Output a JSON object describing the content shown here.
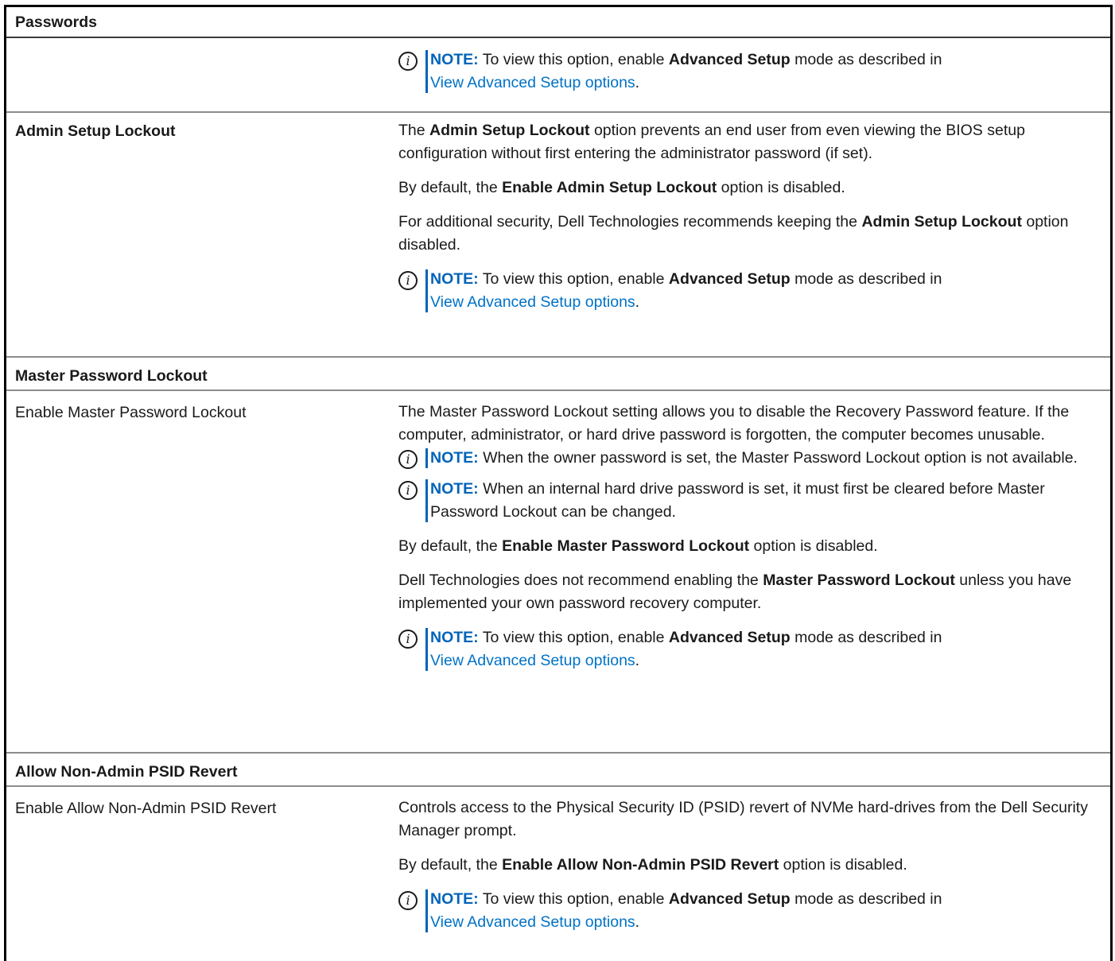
{
  "sections": {
    "passwords": {
      "title": "Passwords",
      "note": {
        "label": "NOTE:",
        "text_a": "To view this option, enable",
        "bold": "Advanced Setup",
        "text_b": "mode as described in",
        "link": "View Advanced Setup options",
        "end": "."
      }
    },
    "admin_lockout": {
      "label": "Admin Setup Lockout",
      "p1_a": "The",
      "p1_bold": "Admin Setup Lockout",
      "p1_b": "option prevents an end user from even viewing the BIOS setup configuration without first entering the administrator password (if set).",
      "p2_a": "By default, the",
      "p2_bold": "Enable Admin Setup Lockout",
      "p2_b": "option is disabled.",
      "p3_a": "For additional security, Dell Technologies recommends keeping the",
      "p3_bold": "Admin Setup Lockout",
      "p3_b": "option disabled.",
      "note": {
        "label": "NOTE:",
        "text_a": "To view this option, enable",
        "bold": "Advanced Setup",
        "text_b": "mode as described in",
        "link": "View Advanced Setup options",
        "end": "."
      }
    },
    "master_lockout": {
      "title": "Master Password Lockout",
      "label": "Enable Master Password Lockout",
      "p1": "The Master Password Lockout setting allows you to disable the Recovery Password feature. If the computer, administrator, or hard drive password is forgotten, the computer becomes unusable.",
      "note1_label": "NOTE:",
      "note1_text": "When the owner password is set, the Master Password Lockout option is not available.",
      "note2_label": "NOTE:",
      "note2_text": "When an internal hard drive password is set, it must first be cleared before Master Password Lockout can be changed.",
      "p2_a": "By default, the",
      "p2_bold": "Enable Master Password Lockout",
      "p2_b": "option is disabled.",
      "p3_a": "Dell Technologies does not recommend enabling the",
      "p3_bold": "Master Password Lockout",
      "p3_b": "unless you have implemented your own password recovery computer.",
      "note3": {
        "label": "NOTE:",
        "text_a": "To view this option, enable",
        "bold": "Advanced Setup",
        "text_b": "mode as described in",
        "link": "View Advanced Setup options",
        "end": "."
      }
    },
    "psid": {
      "title": "Allow Non-Admin PSID Revert",
      "label": "Enable Allow Non-Admin PSID Revert",
      "p1": "Controls access to the Physical Security ID (PSID) revert of NVMe hard-drives from the Dell Security Manager prompt.",
      "p2_a": "By default, the",
      "p2_bold": "Enable Allow Non-Admin PSID Revert",
      "p2_b": "option is disabled.",
      "note": {
        "label": "NOTE:",
        "text_a": "To view this option, enable",
        "bold": "Advanced Setup",
        "text_b": "mode as described in",
        "link": "View Advanced Setup options",
        "end": "."
      }
    }
  },
  "icon_name": "info-icon",
  "colors": {
    "note_blue": "#0063b8",
    "link_blue": "#0072c6"
  }
}
